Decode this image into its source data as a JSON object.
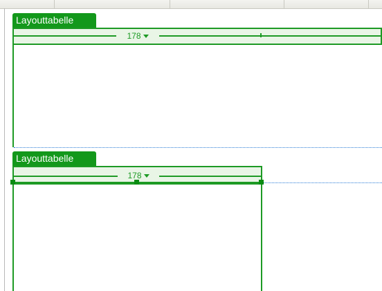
{
  "tables": [
    {
      "tab_label": "Layouttabelle",
      "width_label": "178"
    },
    {
      "tab_label": "Layouttabelle",
      "width_label": "178"
    }
  ]
}
